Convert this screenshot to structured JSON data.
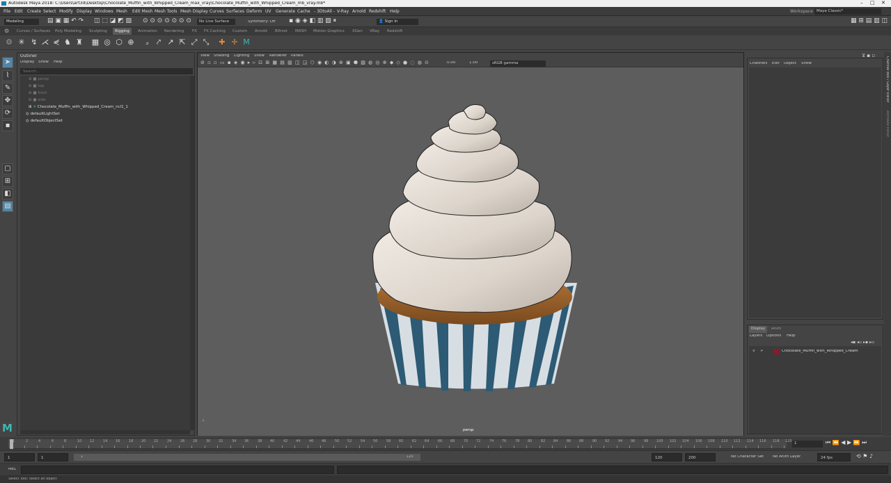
{
  "title": "Autodesk Maya 2018: C:\\Users\\art3d\\Desktop\\Chocolate_Muffin_with_Whipped_Cream_max_vray\\Chocolate_Muffin_with_Whipped_Cream_mb_vray.mb*",
  "menu": [
    "File",
    "Edit",
    "Create",
    "Select",
    "Modify",
    "Display",
    "Windows",
    "Mesh",
    "Edit Mesh",
    "Mesh Tools",
    "Mesh Display",
    "Curves",
    "Surfaces",
    "Deform",
    "UV",
    "Generate",
    "Cache",
    "- 3DtoAll -",
    "V-Ray",
    "Arnold",
    "Redshift",
    "Help"
  ],
  "workspace": {
    "label": "Workspace :",
    "value": "Maya Classic*"
  },
  "status": {
    "mode": "Modeling",
    "live_surface": "No Live Surface",
    "symmetry": "Symmetry: Off",
    "sign_in": "Sign In"
  },
  "shelf_tabs": [
    "Curves / Surfaces",
    "Poly Modeling",
    "Sculpting",
    "Rigging",
    "Animation",
    "Rendering",
    "FX",
    "FX Caching",
    "Custom",
    "Arnold",
    "Bifrost",
    "MASH",
    "Motion Graphics",
    "XGen",
    "VRay",
    "Redshift"
  ],
  "shelf_active": "Rigging",
  "outliner": {
    "title": "Outliner",
    "menu": [
      "Display",
      "Show",
      "Help"
    ],
    "search_placeholder": "Search...",
    "items": [
      {
        "label": "persp",
        "dim": true
      },
      {
        "label": "top",
        "dim": true
      },
      {
        "label": "front",
        "dim": true
      },
      {
        "label": "side",
        "dim": true
      },
      {
        "label": "Chocolate_Muffin_with_Whipped_Cream_ncl1_1",
        "dim": false
      },
      {
        "label": "defaultLightSet",
        "dim": false
      },
      {
        "label": "defaultObjectSet",
        "dim": false
      }
    ]
  },
  "viewport": {
    "menu": [
      "View",
      "Shading",
      "Lighting",
      "Show",
      "Renderer",
      "Panels"
    ],
    "exposure": "0.00",
    "gamma": "1.00",
    "color_space": "sRGB gamma",
    "camera_label": "persp"
  },
  "channel_box": {
    "menu": [
      "Channels",
      "Edit",
      "Object",
      "Show"
    ]
  },
  "layer_editor": {
    "tabs": [
      "Display",
      "Anim"
    ],
    "menu": [
      "Layers",
      "Options",
      "Help"
    ],
    "layer": {
      "v": "V",
      "p": "P",
      "name": "Chocolate_Muffin_with_Whipped_Cream",
      "color": "#8a1a2a"
    }
  },
  "side_tabs": [
    "Channel Box / Layer Editor",
    "Attribute Editor"
  ],
  "timeline": {
    "ticks": [
      "1",
      "2",
      "4",
      "6",
      "8",
      "10",
      "12",
      "14",
      "16",
      "18",
      "20",
      "22",
      "24",
      "26",
      "28",
      "30",
      "32",
      "34",
      "36",
      "38",
      "40",
      "42",
      "44",
      "46",
      "48",
      "50",
      "52",
      "54",
      "56",
      "58",
      "60",
      "62",
      "64",
      "66",
      "68",
      "70",
      "72",
      "74",
      "76",
      "78",
      "80",
      "82",
      "84",
      "86",
      "88",
      "90",
      "92",
      "94",
      "96",
      "98",
      "100",
      "102",
      "104",
      "106",
      "108",
      "110",
      "112",
      "114",
      "116",
      "118",
      "120"
    ],
    "current_frame": "1"
  },
  "range": {
    "start": "1",
    "playback_start": "1",
    "range_start_label": "1",
    "range_end_label": "120",
    "playback_end": "120",
    "end": "200",
    "character_set": "No Character Set",
    "anim_layer": "No Anim Layer",
    "fps": "24 fps"
  },
  "command": {
    "label": "MEL"
  },
  "help_line": "Select Tool: select an object",
  "colors": {
    "accent": "#5285a6",
    "bg": "#444444",
    "viewport_bg": "#5d5d5d"
  }
}
